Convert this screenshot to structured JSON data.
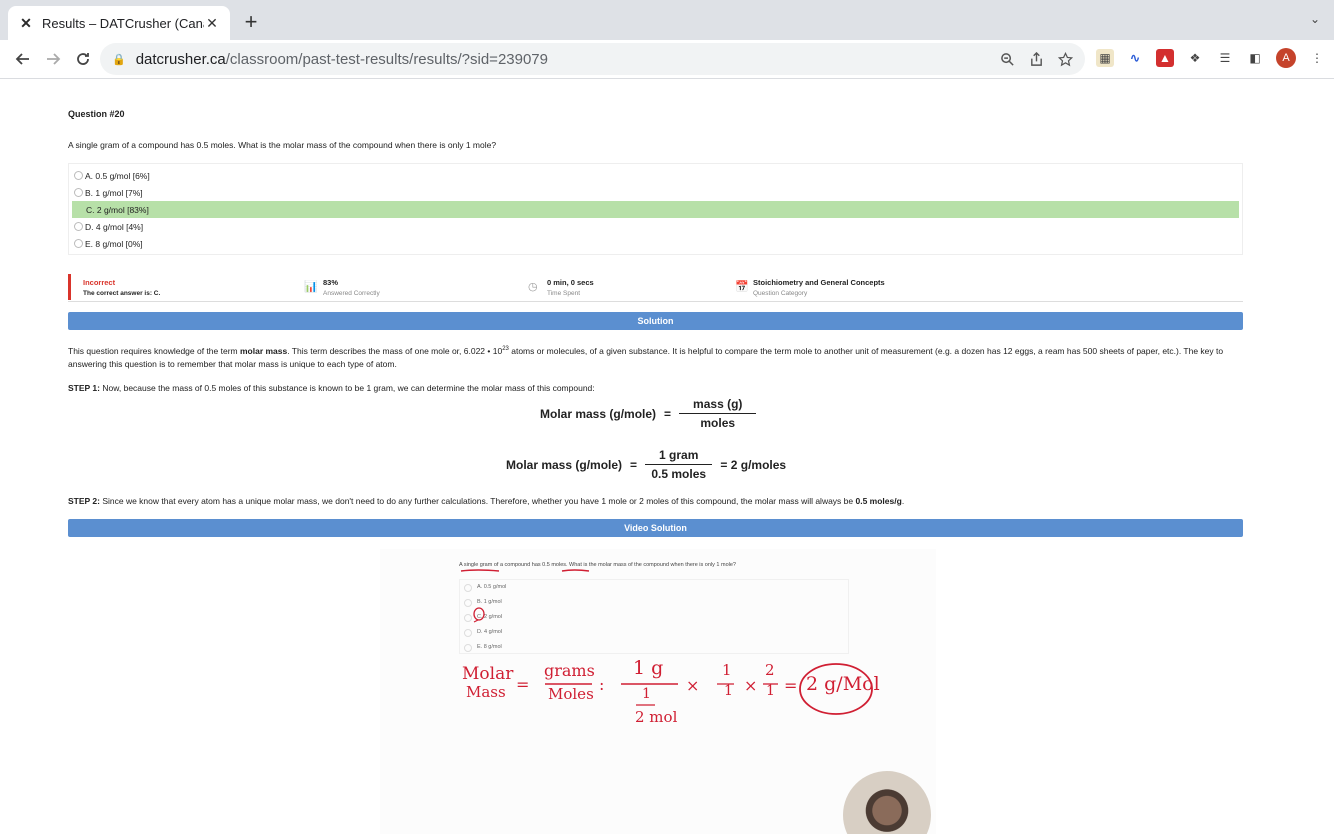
{
  "browser": {
    "tab_title": "Results – DATCrusher (Canadia",
    "tab_close": "✕",
    "new_tab": "+",
    "tab_menu": "⌄",
    "url_host": "datcrusher.ca",
    "url_path": "/classroom/past-test-results/results/?sid=239079",
    "avatar_letter": "A"
  },
  "question": {
    "number": "Question #20",
    "stem": "A single gram of a compound has 0.5 moles. What is the molar mass of the compound when there is only 1 mole?",
    "options": [
      {
        "label": "A. 0.5 g/mol [6%]",
        "correct": false
      },
      {
        "label": "B. 1 g/mol [7%]",
        "correct": false
      },
      {
        "label": "C. 2 g/mol [83%]",
        "correct": true
      },
      {
        "label": "D. 4 g/mol [4%]",
        "correct": false
      },
      {
        "label": "E. 8 g/mol [0%]",
        "correct": false
      }
    ]
  },
  "stats": {
    "result": "Incorrect",
    "correct_answer": "The correct answer is: C.",
    "percent": "83%",
    "percent_label": "Answered Correctly",
    "time": "0 min, 0 secs",
    "time_label": "Time Spent",
    "category": "Stoichiometry and General Concepts",
    "category_label": "Question Category"
  },
  "solution": {
    "banner": "Solution",
    "intro_1": "This question requires knowledge of the term ",
    "intro_bold": "molar mass",
    "intro_2": ". This term describes the mass of one mole or, 6.022 • 10",
    "intro_sup": "23",
    "intro_3": " atoms or molecules, of a given substance. It is helpful to compare the term mole to another unit of measurement (e.g. a dozen has 12 eggs, a ream has 500 sheets of paper, etc.). The key to answering this question is to remember that molar mass is unique to each type of atom.",
    "step1_label": "STEP 1:",
    "step1_text": " Now, because the mass of 0.5 moles of this substance is known to be 1 gram, we can determine the molar mass of this compound:",
    "formula1_lhs": "Molar mass (g/mole)",
    "formula1_eq": "=",
    "formula1_num": "mass (g)",
    "formula1_den": "moles",
    "formula2_lhs": "Molar mass (g/mole)",
    "formula2_eq": "=",
    "formula2_num": "1 gram",
    "formula2_den": "0.5 moles",
    "formula2_rhs": "=  2 g/moles",
    "step2_label": "STEP 2:",
    "step2_text": " Since we know that every atom has a unique molar mass, we don't need to do any further calculations. Therefore, whether you have 1 mole or 2 moles of this compound, the molar mass will always be ",
    "step2_bold": "0.5 moles/g",
    "step2_end": "."
  },
  "video": {
    "banner": "Video Solution",
    "question": "A single gram of a compound has 0.5 moles. What is the molar mass of the compound when there is only 1 mole?",
    "options": [
      "A. 0.5 g/mol",
      "B. 1 g/mol",
      "C. 2 g/mol",
      "D. 4 g/mol",
      "E. 8 g/mol"
    ],
    "hand_molar": "Molar",
    "hand_mass": "Mass",
    "hand_grams": "grams",
    "hand_moles": "Moles",
    "hand_1g": "1 g",
    "hand_1": "1",
    "hand_2mol": "2 mol",
    "hand_x1": "1",
    "hand_x1b": "1",
    "hand_x2": "2",
    "hand_x2b": "1",
    "hand_answer": "2 g/Mol"
  }
}
